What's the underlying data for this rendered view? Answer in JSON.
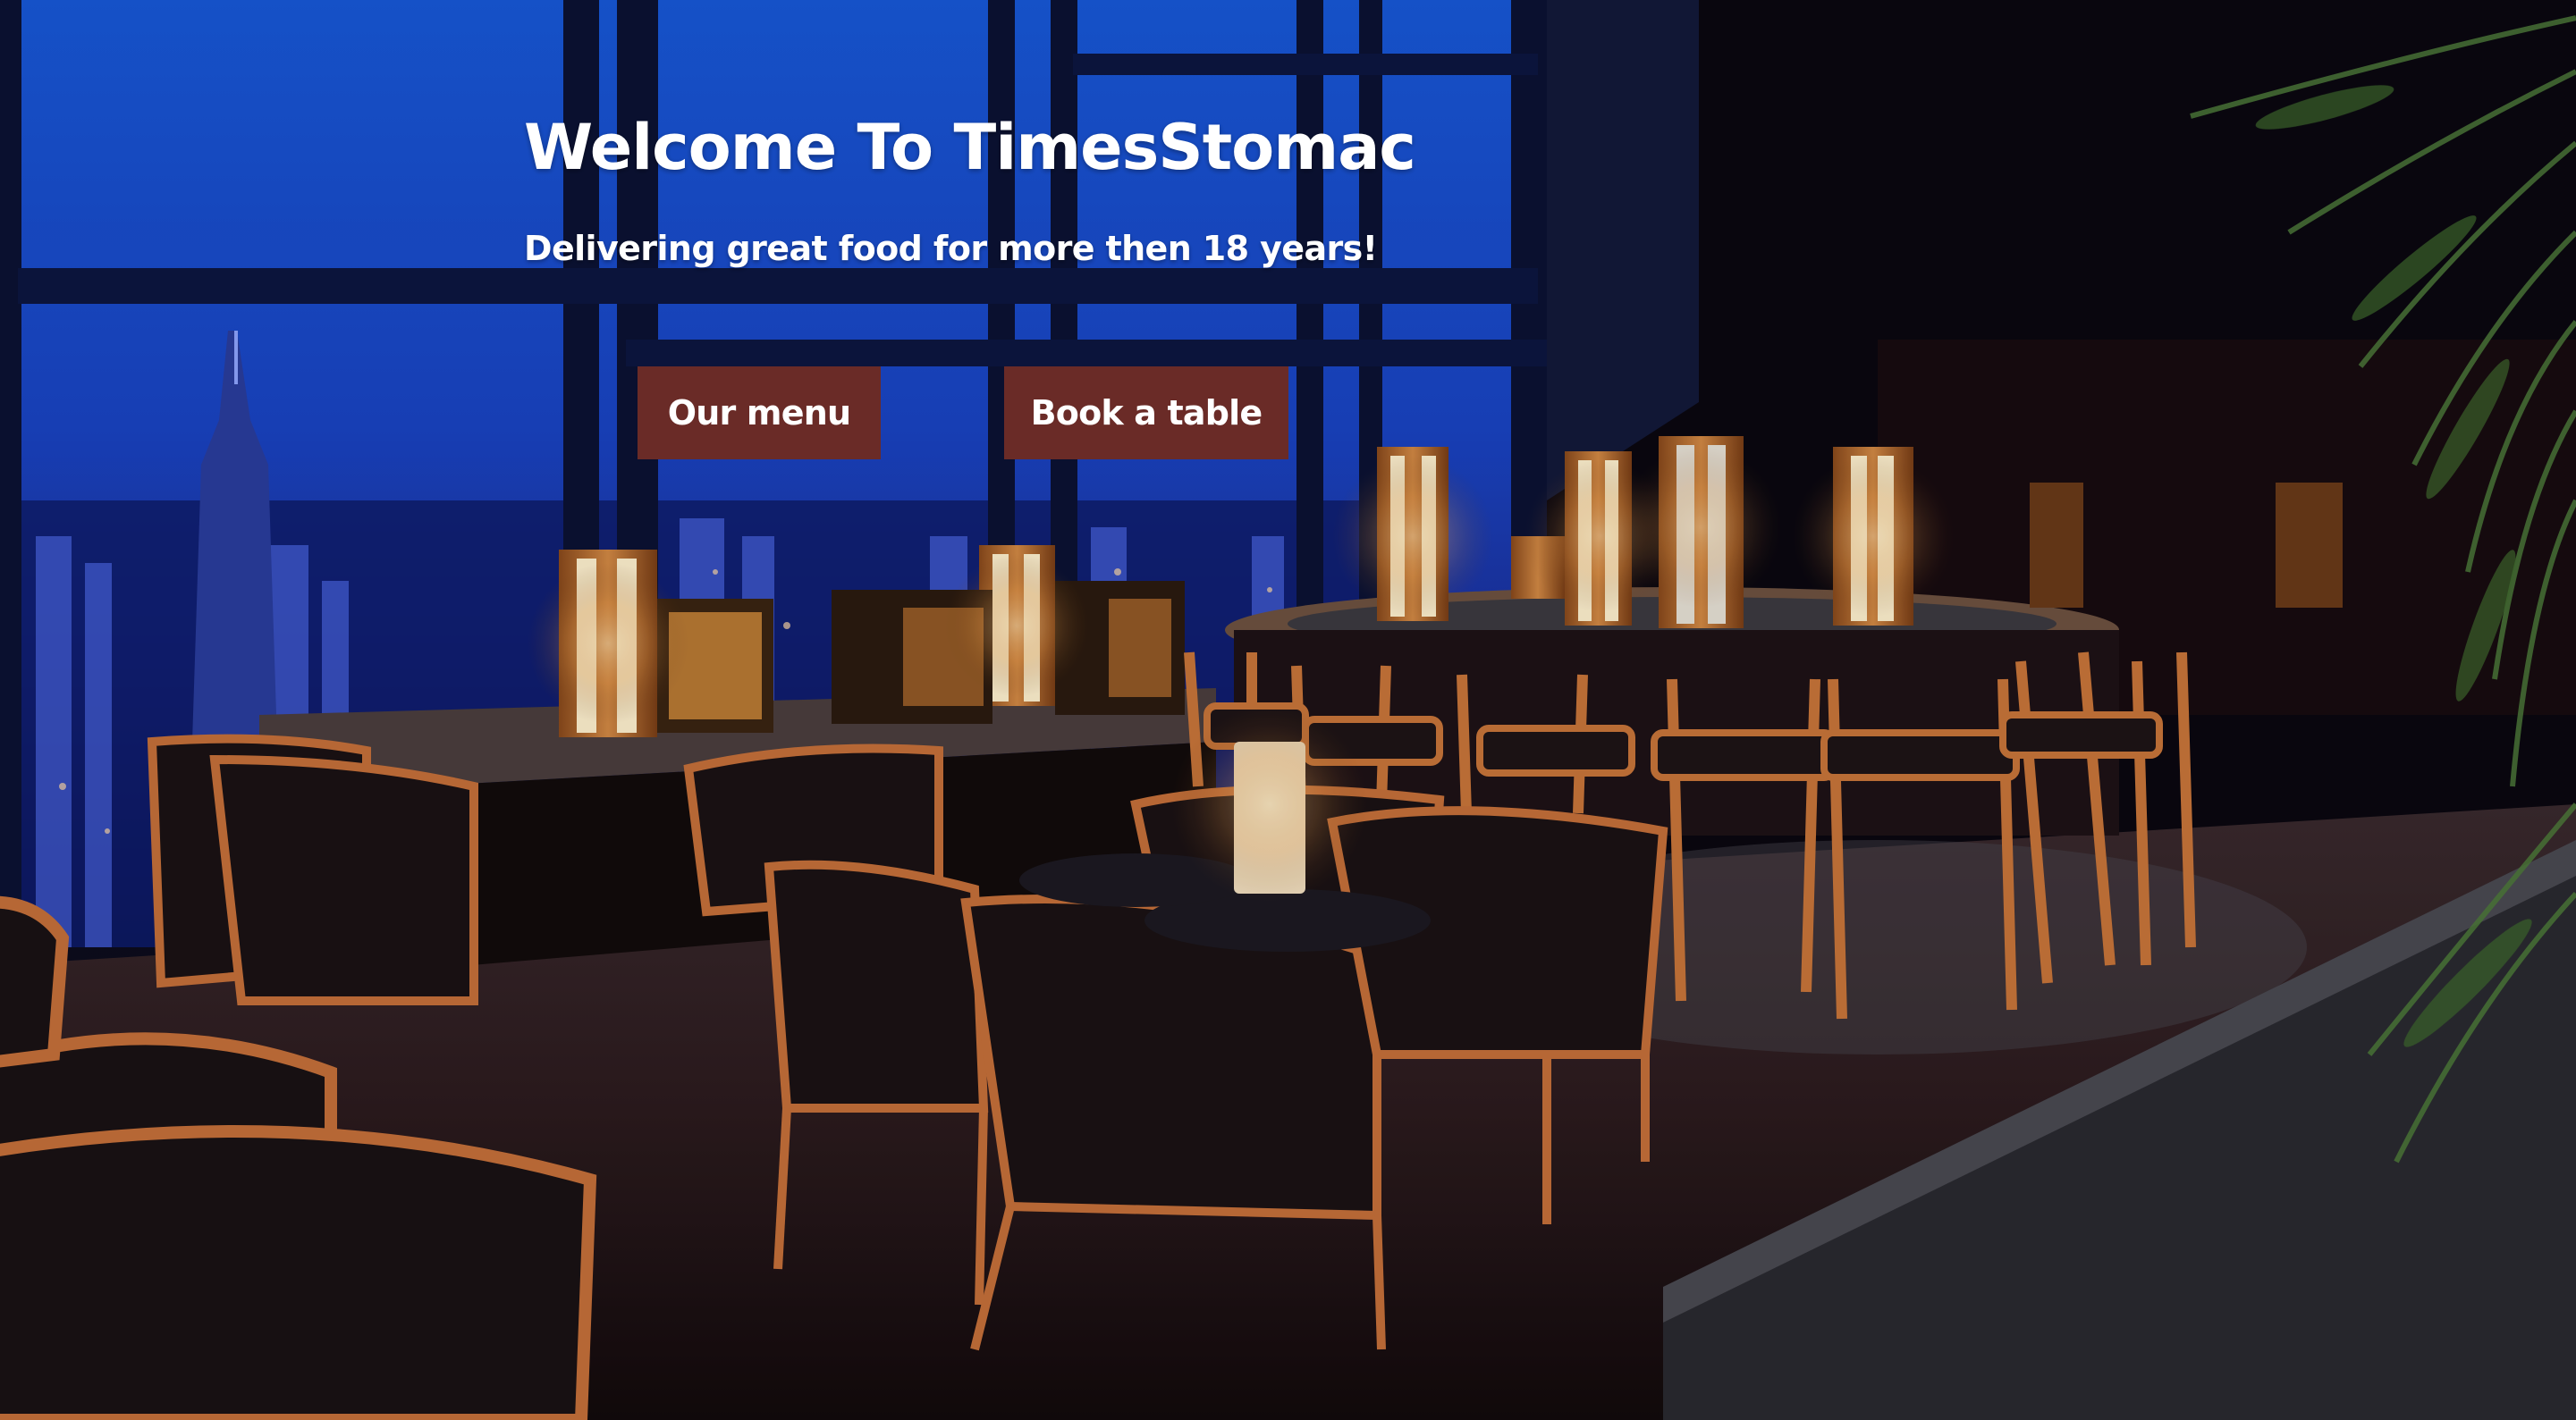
{
  "hero": {
    "title": "Welcome To TimesStomac",
    "subtitle": "Delivering great food for more then 18 years!",
    "buttons": {
      "menu_label": "Our menu",
      "book_label": "Book a table"
    }
  },
  "colors": {
    "button_bg": "#6a2b27",
    "text": "#ffffff",
    "sky": "#1d3fb8"
  }
}
